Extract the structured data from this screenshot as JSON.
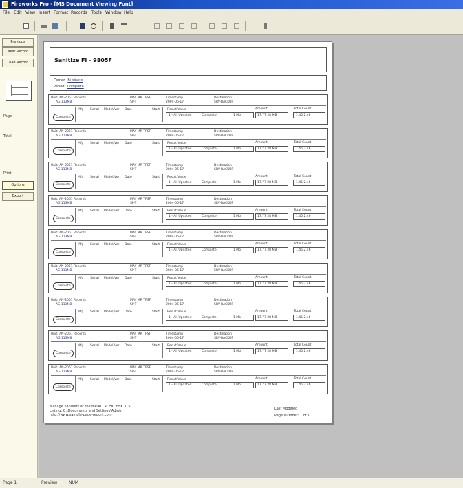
{
  "window": {
    "title": "Fireworks Pro - [MS Document Viewing Font]"
  },
  "menu": [
    "File",
    "Edit",
    "View",
    "Insert",
    "Format",
    "Records",
    "Tools",
    "Window",
    "Help"
  ],
  "toolbar": {
    "buttons": [
      "new-icon",
      "print-icon",
      "preview-icon",
      "save-icon",
      "zoom-icon",
      "export-icon",
      "first-page-icon",
      "prev-page-icon",
      "next-page-icon",
      "last-page-icon",
      "close-icon"
    ]
  },
  "sidebar": {
    "top_buttons": [
      "Previous",
      "Next Record",
      "Load Record"
    ],
    "labels": [
      "Page",
      "Total",
      "Print"
    ],
    "bottom_buttons": [
      "Options",
      "Export"
    ]
  },
  "report": {
    "title": "Sanitize Fl - 9805F",
    "meta": [
      {
        "label": "Owner",
        "value": "Business"
      },
      {
        "label": "Period",
        "value": "Complete"
      }
    ],
    "record_fields": {
      "unit": "Unit: AN-2061 Records",
      "sub": "AG 113MB",
      "status_hdr": "MAY MR TPSF",
      "status_val": "SP-T",
      "ts_hdr": "Timestamp",
      "ts_val": "2004-06-17",
      "dest_hdr": "Destination",
      "dest_val": "SRV-BACKUP",
      "cols": [
        "Mfg",
        "Serial",
        "Model/Ver",
        "Date",
        "Start"
      ],
      "row_val": "Complete",
      "detail_hdr": "Result Value",
      "detail_1": "1 - All Updated",
      "detail_2": "Complete",
      "detail_3": "1 Mb",
      "a_hdr": "Amount",
      "a_val": "17.77  28 MB",
      "b_hdr": "Total Count",
      "b_val": "1.45  2.46"
    },
    "record_count": 9,
    "footer_left": [
      "Manage handlers at the file:ALLRCHKCHEK.XLS",
      "Listing: C:\\Documents and Settings\\Admin",
      "http://www.sample-page-report.com"
    ],
    "footer_right": [
      "Last Modified",
      "Page Number: 1 of 1"
    ]
  },
  "status": {
    "left": "Page 1",
    "middle": "Preview",
    "right": "NUM"
  }
}
